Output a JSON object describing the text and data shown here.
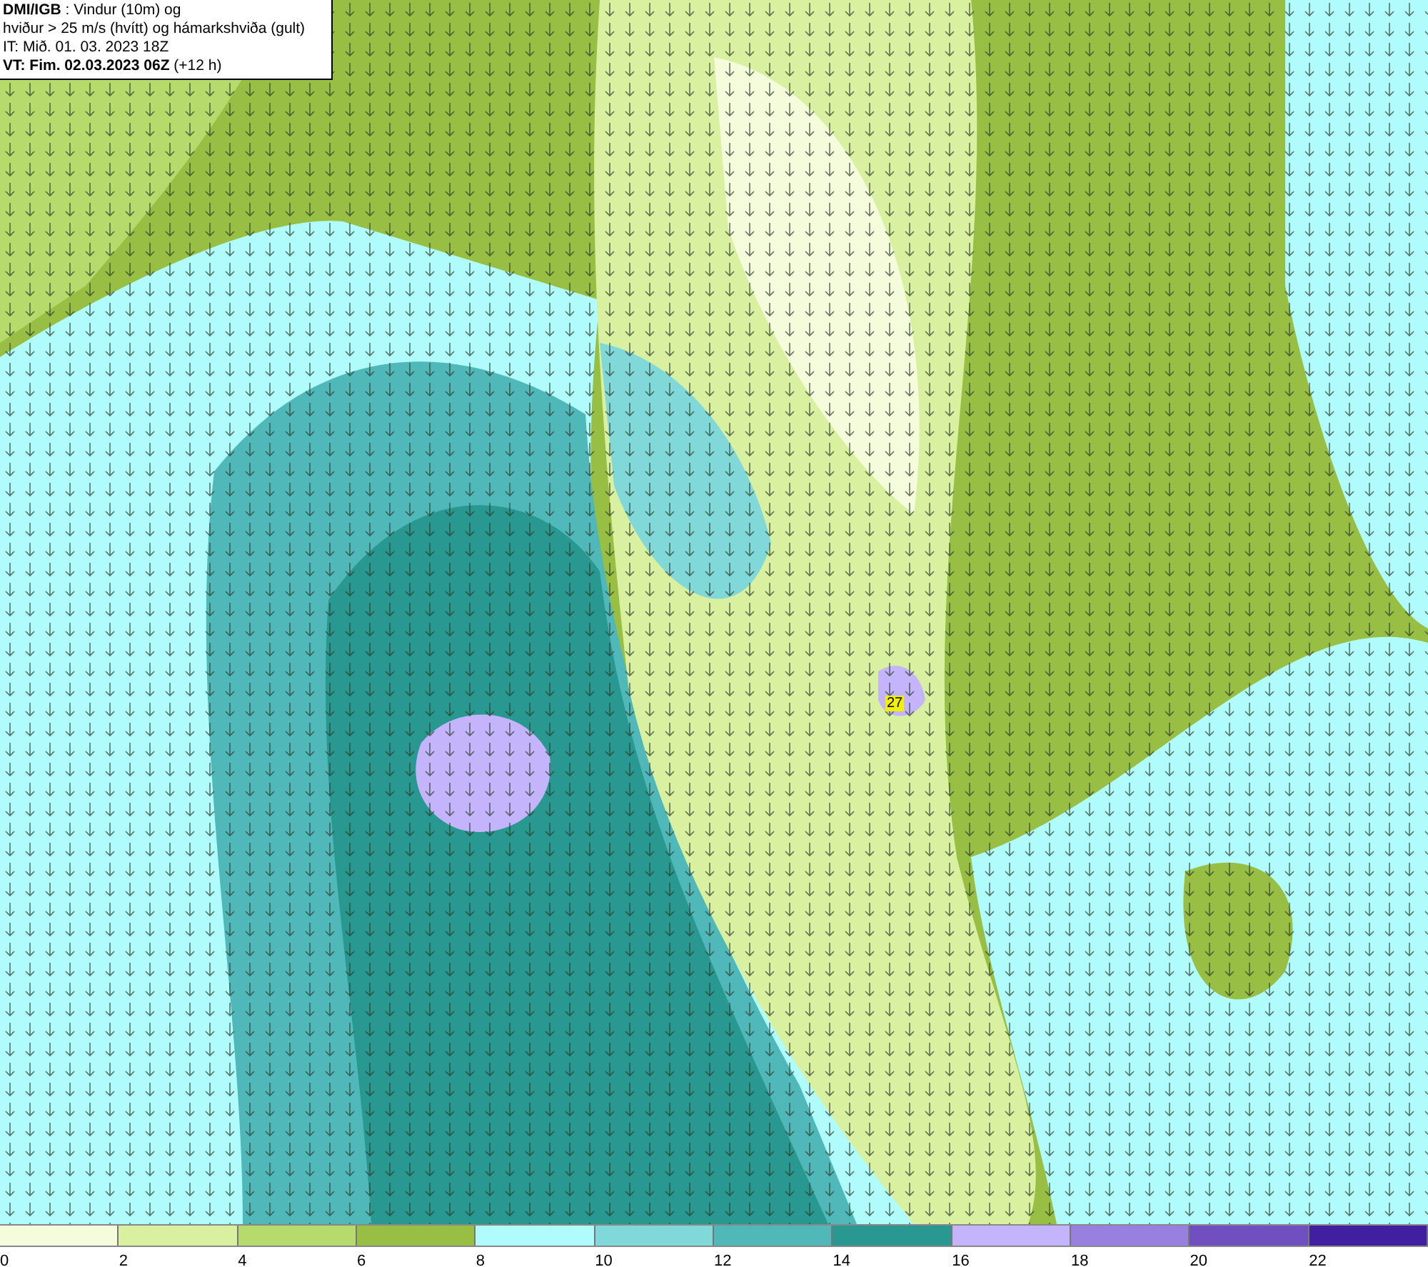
{
  "header": {
    "lines": [
      "**DMI/IGB** : Vindur (10m) og",
      "hviður > 25 m/s (hvítt) og hámarkshviða (gult)",
      "IT: Mið. 01. 03. 2023 18Z",
      "**VT: Fim. 02.03.2023 06Z** (+12 h)"
    ]
  },
  "map": {
    "gust_label": "27"
  },
  "legend": {
    "bins": [
      {
        "color": "#f4fcdc",
        "tick": "0"
      },
      {
        "color": "#d8f0a0",
        "tick": "2"
      },
      {
        "color": "#b6da6c",
        "tick": "4"
      },
      {
        "color": "#98be44",
        "tick": "6"
      },
      {
        "color": "#b0fcfc",
        "tick": "8"
      },
      {
        "color": "#80d8d8",
        "tick": "10"
      },
      {
        "color": "#50b8b8",
        "tick": "12"
      },
      {
        "color": "#289890",
        "tick": "14"
      },
      {
        "color": "#c4b4fc",
        "tick": "16"
      },
      {
        "color": "#9880e0",
        "tick": "18"
      },
      {
        "color": "#7050c0",
        "tick": "20"
      },
      {
        "color": "#4020a0",
        "tick": "22"
      }
    ]
  }
}
